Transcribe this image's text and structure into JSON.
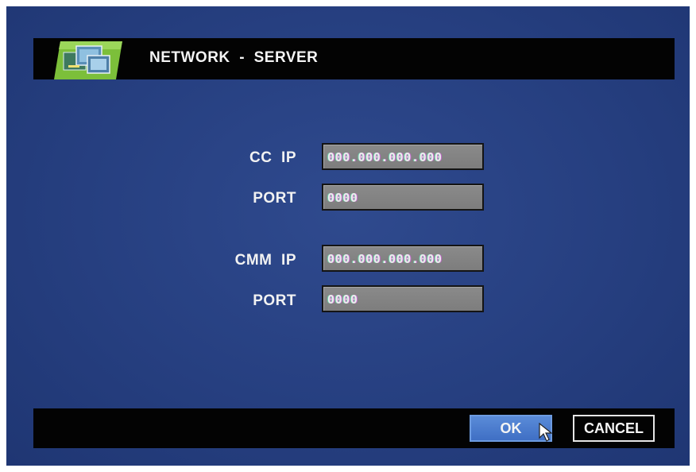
{
  "header": {
    "title": "NETWORK  -  SERVER",
    "icon": "network-server-icon"
  },
  "form": {
    "cc_ip": {
      "label": "CC  IP",
      "value": "000.000.000.000"
    },
    "cc_port": {
      "label": "PORT",
      "value": "0000"
    },
    "cmm_ip": {
      "label": "CMM  IP",
      "value": "000.000.000.000"
    },
    "cmm_port": {
      "label": "PORT",
      "value": "0000"
    }
  },
  "footer": {
    "ok_label": "OK",
    "cancel_label": "CANCEL"
  },
  "colors": {
    "background": "#263f80",
    "bar": "#030303",
    "field": "#838383",
    "ok_button": "#4a7bcf"
  }
}
